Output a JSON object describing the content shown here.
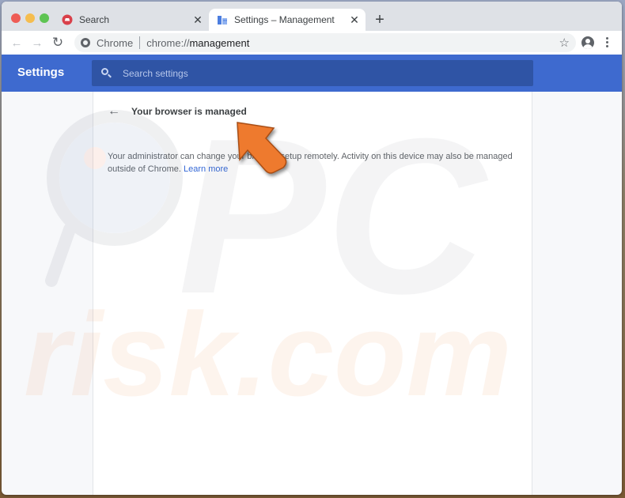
{
  "browser": {
    "tabs": [
      {
        "title": "Search",
        "icon": "search-favicon",
        "active": false
      },
      {
        "title": "Settings – Management",
        "icon": "settings-favicon",
        "active": true
      }
    ],
    "close_glyph": "✕",
    "new_tab_glyph": "+",
    "back_glyph": "←",
    "forward_glyph": "→",
    "reload_glyph": "↻",
    "star_glyph": "☆",
    "omnibox": {
      "chip_label": "Chrome",
      "url_scheme": "chrome://",
      "url_host": "management"
    }
  },
  "settings": {
    "header_title": "Settings",
    "search_placeholder": "Search settings",
    "accent_color": "#3e6acf"
  },
  "management": {
    "back_glyph": "←",
    "title": "Your browser is managed",
    "description": "Your administrator can change your browser setup remotely. Activity on this device may also be managed outside of Chrome.",
    "learn_more": "Learn more"
  },
  "overlay": {
    "watermark_top": "PC",
    "watermark_bottom": "risk.com",
    "arrow_color": "#ee7a2e"
  }
}
